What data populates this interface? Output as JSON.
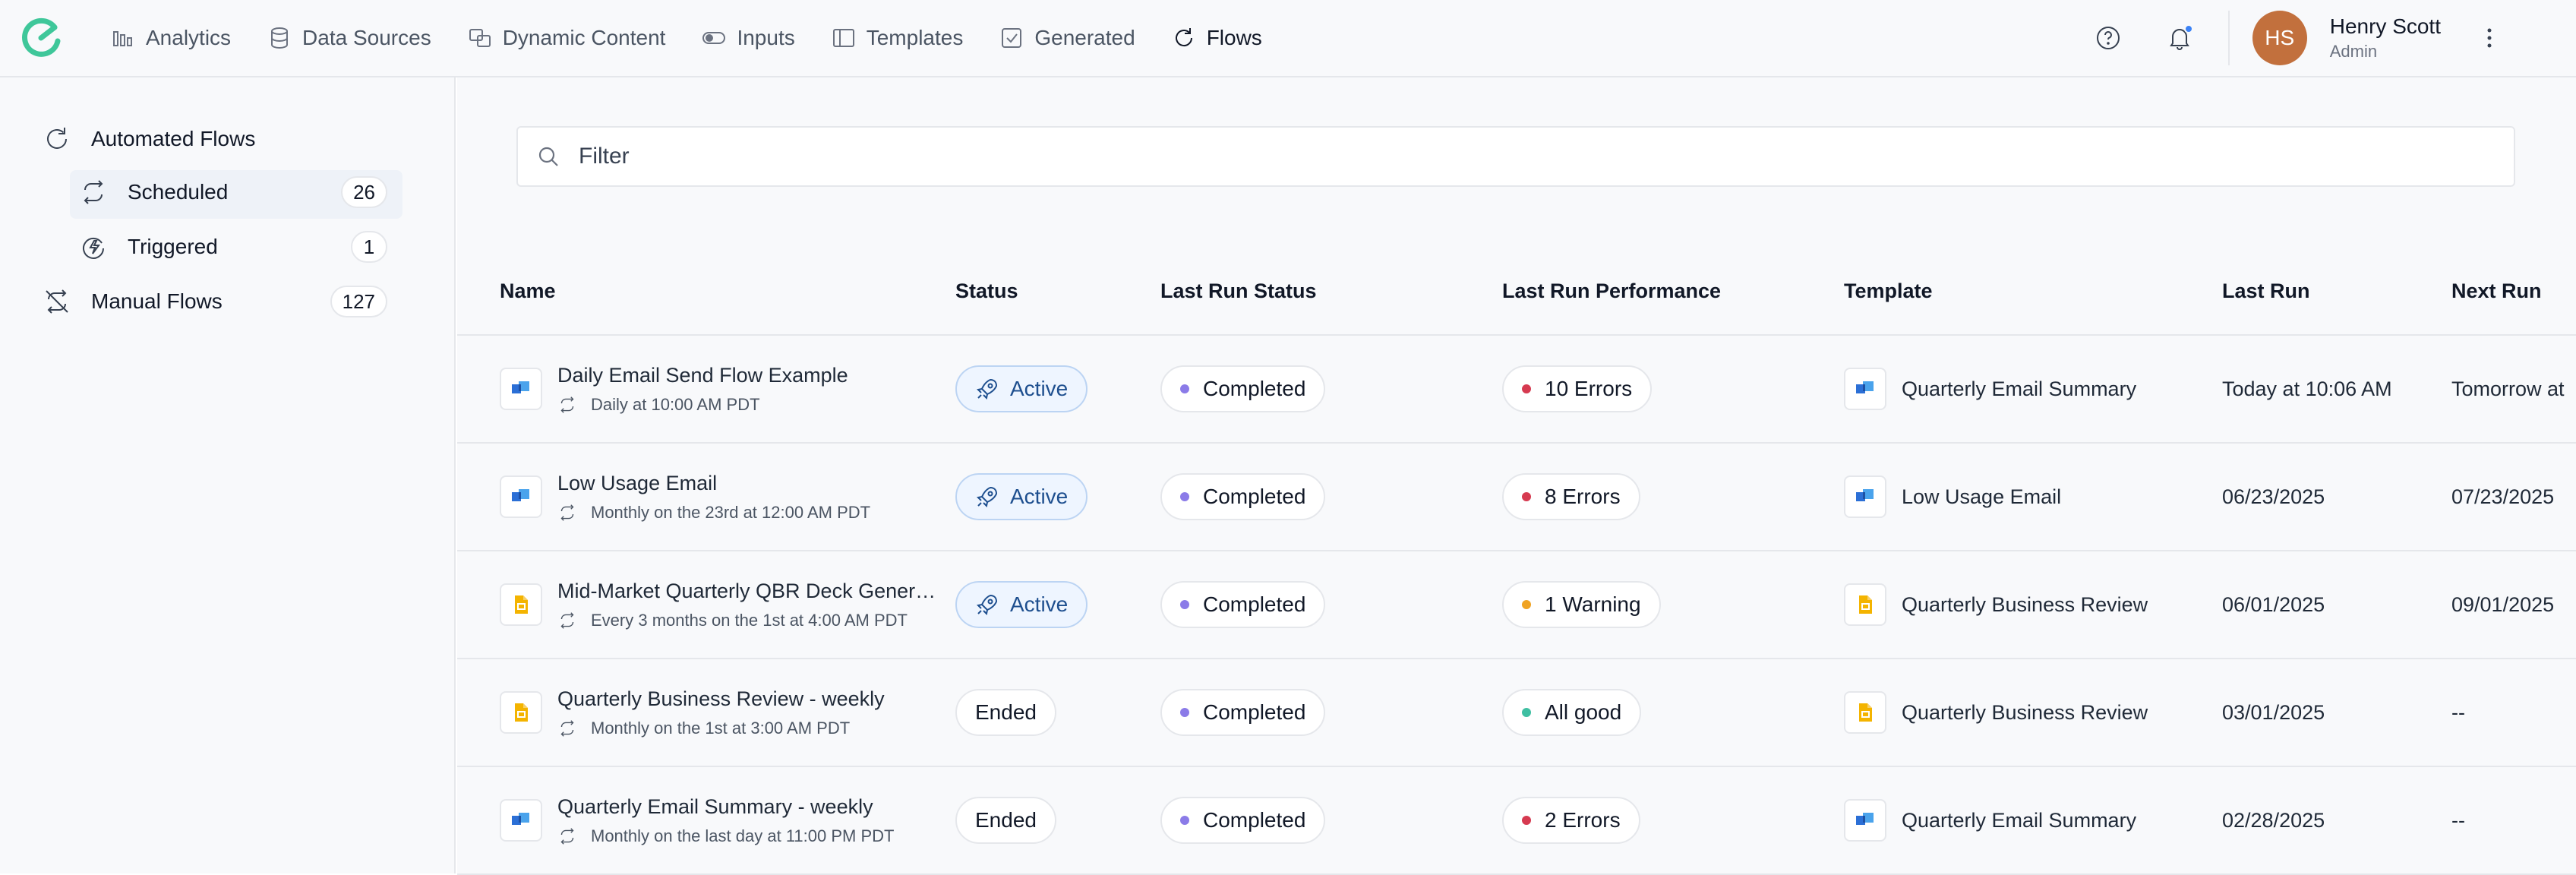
{
  "nav": {
    "items": [
      {
        "label": "Analytics",
        "icon": "analytics-icon",
        "active": false
      },
      {
        "label": "Data Sources",
        "icon": "database-icon",
        "active": false
      },
      {
        "label": "Dynamic Content",
        "icon": "dynamic-content-icon",
        "active": false
      },
      {
        "label": "Inputs",
        "icon": "input-toggle-icon",
        "active": false
      },
      {
        "label": "Templates",
        "icon": "template-icon",
        "active": false
      },
      {
        "label": "Generated",
        "icon": "generated-icon",
        "active": false
      },
      {
        "label": "Flows",
        "icon": "flows-refresh-icon",
        "active": true
      }
    ]
  },
  "user": {
    "initials": "HS",
    "name": "Henry Scott",
    "role": "Admin",
    "avatar_color": "#c2703d"
  },
  "sidebar": {
    "automated": {
      "label": "Automated Flows"
    },
    "scheduled": {
      "label": "Scheduled",
      "count": "26"
    },
    "triggered": {
      "label": "Triggered",
      "count": "1"
    },
    "manual": {
      "label": "Manual Flows",
      "count": "127"
    }
  },
  "filter": {
    "placeholder": "Filter"
  },
  "table": {
    "headers": {
      "name": "Name",
      "status": "Status",
      "last_run_status": "Last Run Status",
      "last_run_performance": "Last Run Performance",
      "template": "Template",
      "last_run": "Last Run",
      "next_run": "Next Run"
    },
    "rows": [
      {
        "name": "Daily Email Send Flow Example",
        "schedule": "Daily at 10:00 AM PDT",
        "type_icon": "email-template-icon",
        "status": "Active",
        "last_run_status": "Completed",
        "performance": "10 Errors",
        "performance_color": "#d63a50",
        "template": "Quarterly Email Summary",
        "template_icon": "email-template-icon",
        "last_run": "Today at 10:06 AM",
        "next_run": "Tomorrow at"
      },
      {
        "name": "Low Usage Email",
        "schedule": "Monthly on the 23rd at 12:00 AM PDT",
        "type_icon": "email-template-icon",
        "status": "Active",
        "last_run_status": "Completed",
        "performance": "8 Errors",
        "performance_color": "#d63a50",
        "template": "Low Usage Email",
        "template_icon": "email-template-icon",
        "last_run": "06/23/2025",
        "next_run": "07/23/2025"
      },
      {
        "name": "Mid-Market Quarterly QBR Deck Generation",
        "schedule": "Every 3 months on the 1st at 4:00 AM PDT",
        "type_icon": "slides-template-icon",
        "status": "Active",
        "last_run_status": "Completed",
        "performance": "1 Warning",
        "performance_color": "#f0a323",
        "template": "Quarterly Business Review",
        "template_icon": "slides-template-icon",
        "last_run": "06/01/2025",
        "next_run": "09/01/2025"
      },
      {
        "name": "Quarterly Business Review - weekly",
        "schedule": "Monthly on the 1st at 3:00 AM PDT",
        "type_icon": "slides-template-icon",
        "status": "Ended",
        "last_run_status": "Completed",
        "performance": "All good",
        "performance_color": "#3fbfa2",
        "template": "Quarterly Business Review",
        "template_icon": "slides-template-icon",
        "last_run": "03/01/2025",
        "next_run": "--"
      },
      {
        "name": "Quarterly Email Summary - weekly",
        "schedule": "Monthly on the last day at 11:00 PM PDT",
        "type_icon": "email-template-icon",
        "status": "Ended",
        "last_run_status": "Completed",
        "performance": "2 Errors",
        "performance_color": "#d63a50",
        "template": "Quarterly Email Summary",
        "template_icon": "email-template-icon",
        "last_run": "02/28/2025",
        "next_run": "--"
      }
    ]
  },
  "colors": {
    "accent": "#1e4f8f",
    "completed_dot": "#8b7be8",
    "logo": "#3fc79a"
  }
}
